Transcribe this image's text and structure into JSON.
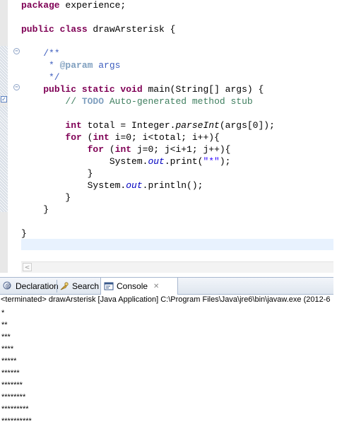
{
  "editor": {
    "lines": [
      "package experience;",
      "",
      "public class drawArsterisk {",
      "",
      "    /**",
      "     * @param args",
      "     */",
      "    public static void main(String[] args) {",
      "        // TODO Auto-generated method stub",
      "",
      "        int total = Integer.parseInt(args[0]);",
      "        for (int i=0; i<total; i++){",
      "            for (int j=0; j<i+1; j++){",
      "                System.out.print(\"*\");",
      "            }",
      "            System.out.println();",
      "        }",
      "    }",
      "",
      "}"
    ],
    "colors": {
      "keyword": "#7f0055",
      "comment": "#3f7f5f",
      "javadoc": "#3f5fbf",
      "string": "#2a00ff",
      "static_field": "#0000c0",
      "current_line": "#e8f2fe"
    },
    "icons": [
      "fold-collapse-icon",
      "task-marker-icon",
      "scroll-left-arrow-icon"
    ]
  },
  "tabs": [
    {
      "label": "Declaration",
      "icon": "declaration-icon",
      "active": false
    },
    {
      "label": "Search",
      "icon": "search-icon",
      "active": false
    },
    {
      "label": "Console",
      "icon": "console-icon",
      "active": true,
      "close_icon": "close-icon"
    }
  ],
  "console": {
    "status": "<terminated> drawArsterisk [Java Application] C:\\Program Files\\Java\\jre6\\bin\\javaw.exe (2012-6",
    "output": [
      "*",
      "**",
      "***",
      "****",
      "*****",
      "******",
      "*******",
      "********",
      "*********",
      "**********"
    ]
  }
}
